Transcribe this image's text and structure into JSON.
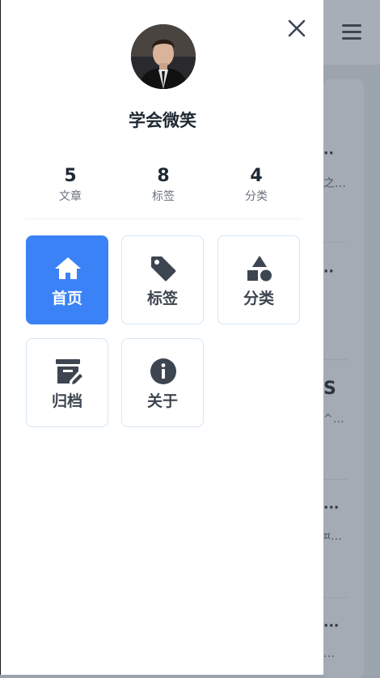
{
  "profile": {
    "name": "学会微笑"
  },
  "stats": [
    {
      "value": "5",
      "label": "文章"
    },
    {
      "value": "8",
      "label": "标签"
    },
    {
      "value": "4",
      "label": "分类"
    }
  ],
  "nav": [
    {
      "label": "首页",
      "icon": "home-icon",
      "active": true
    },
    {
      "label": "标签",
      "icon": "tag-icon",
      "active": false
    },
    {
      "label": "分类",
      "icon": "shapes-icon",
      "active": false
    },
    {
      "label": "归档",
      "icon": "archive-icon",
      "active": false
    },
    {
      "label": "关于",
      "icon": "info-icon",
      "active": false
    }
  ],
  "background_fragments": [
    {
      "text": "·· ",
      "small": false
    },
    {
      "text": "之…",
      "small": true
    },
    {
      "text": "··",
      "small": false
    },
    {
      "text": "S",
      "small": false
    },
    {
      "text": "^…",
      "small": true
    },
    {
      "text": "···",
      "small": false
    },
    {
      "text": "¤…",
      "small": true
    },
    {
      "text": "···",
      "small": false
    },
    {
      "text": "…",
      "small": true
    }
  ],
  "colors": {
    "accent": "#3b82f6",
    "overlay": "#9ca4ae",
    "text": "#1f2933"
  }
}
